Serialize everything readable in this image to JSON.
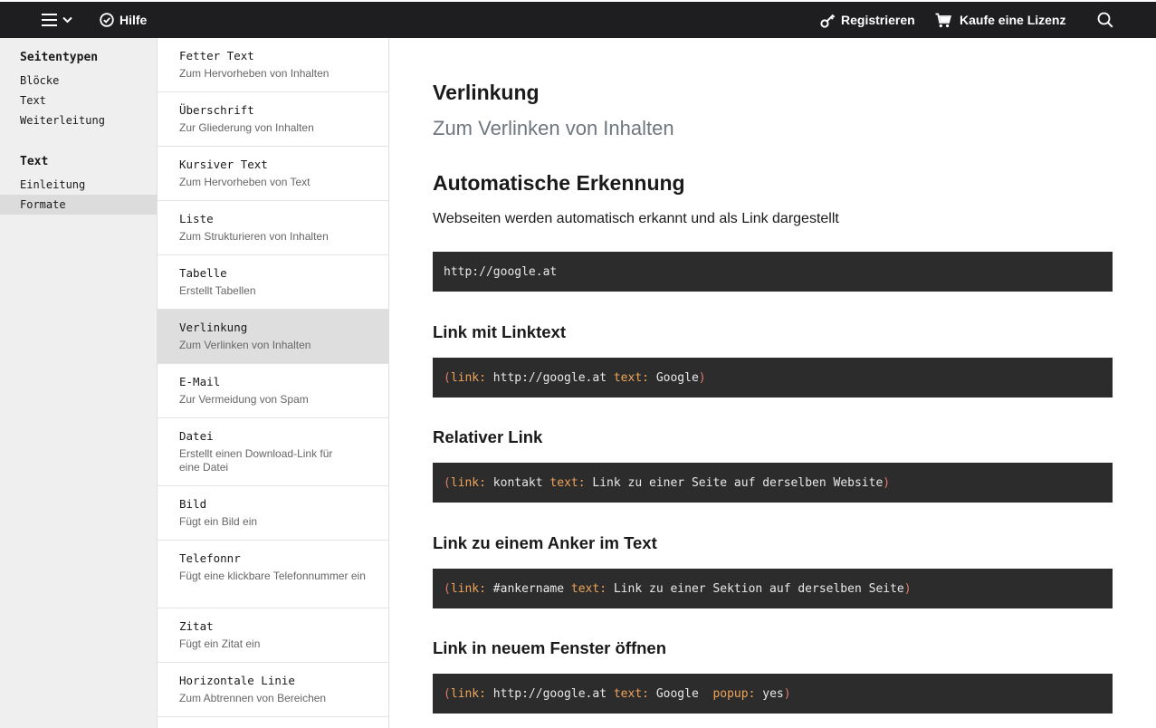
{
  "topbar": {
    "menu_icon": "hamburger-icon",
    "help_label": "Hilfe",
    "register_label": "Registrieren",
    "license_label": "Kaufe eine Lizenz"
  },
  "sidebar": {
    "groups": [
      {
        "heading": "Seitentypen",
        "items": [
          "Blöcke",
          "Text",
          "Weiterleitung"
        ]
      },
      {
        "heading": "Text",
        "items": [
          "Einleitung",
          "Formate"
        ]
      }
    ],
    "active_item": "Formate"
  },
  "subnav": {
    "items": [
      {
        "title": "Fetter Text",
        "desc": "Zum Hervorheben von Inhalten"
      },
      {
        "title": "Überschrift",
        "desc": "Zur Gliederung von Inhalten"
      },
      {
        "title": "Kursiver Text",
        "desc": "Zum Hervorheben von Text"
      },
      {
        "title": "Liste",
        "desc": "Zum Strukturieren von Inhalten"
      },
      {
        "title": "Tabelle",
        "desc": "Erstellt Tabellen"
      },
      {
        "title": "Verlinkung",
        "desc": "Zum Verlinken von Inhalten"
      },
      {
        "title": "E-Mail",
        "desc": "Zur Vermeidung von Spam"
      },
      {
        "title": "Datei",
        "desc": "Erstellt einen Download-Link für eine Datei"
      },
      {
        "title": "Bild",
        "desc": "Fügt ein Bild ein"
      },
      {
        "title": "Telefonnr",
        "desc": "Fügt eine klickbare Telefonnummer ein"
      },
      {
        "title": "Zitat",
        "desc": "Fügt ein Zitat ein"
      },
      {
        "title": "Horizontale Linie",
        "desc": "Zum Abtrennen von Bereichen"
      }
    ],
    "active_title": "Verlinkung"
  },
  "main": {
    "title": "Verlinkung",
    "subtitle": "Zum Verlinken von Inhalten",
    "section_title": "Automatische Erkennung",
    "intro": "Webseiten werden automatisch erkannt und als Link dargestellt",
    "auto_code": "http://google.at",
    "examples": [
      {
        "title": "Link mit Linktext",
        "tokens": [
          {
            "t": "paren",
            "v": "("
          },
          {
            "t": "key",
            "v": "link:"
          },
          {
            "t": "plain",
            "v": " http://google.at "
          },
          {
            "t": "key",
            "v": "text:"
          },
          {
            "t": "plain",
            "v": " Google"
          },
          {
            "t": "paren",
            "v": ")"
          }
        ]
      },
      {
        "title": "Relativer Link",
        "tokens": [
          {
            "t": "paren",
            "v": "("
          },
          {
            "t": "key",
            "v": "link:"
          },
          {
            "t": "plain",
            "v": " kontakt "
          },
          {
            "t": "key",
            "v": "text:"
          },
          {
            "t": "plain",
            "v": " Link zu einer Seite auf derselben Website"
          },
          {
            "t": "paren",
            "v": ")"
          }
        ]
      },
      {
        "title": "Link zu einem Anker im Text",
        "tokens": [
          {
            "t": "paren",
            "v": "("
          },
          {
            "t": "key",
            "v": "link:"
          },
          {
            "t": "plain",
            "v": " #ankername "
          },
          {
            "t": "key",
            "v": "text:"
          },
          {
            "t": "plain",
            "v": " Link zu einer Sektion auf derselben Seite"
          },
          {
            "t": "paren",
            "v": ")"
          }
        ]
      },
      {
        "title": "Link in neuem Fenster öffnen",
        "tokens": [
          {
            "t": "paren",
            "v": "("
          },
          {
            "t": "key",
            "v": "link:"
          },
          {
            "t": "plain",
            "v": " http://google.at "
          },
          {
            "t": "key",
            "v": "text:"
          },
          {
            "t": "plain",
            "v": " Google  "
          },
          {
            "t": "key",
            "v": "popup:"
          },
          {
            "t": "plain",
            "v": " yes"
          },
          {
            "t": "paren",
            "v": ")"
          }
        ]
      }
    ]
  },
  "colors": {
    "topbar_bg": "#1e1e20",
    "sidebar_bg": "#efefef",
    "active_bg": "#dedede",
    "code_bg": "#2c2c2c",
    "code_paren": "#e07c6a",
    "code_key": "#f0a35a",
    "subtitle": "#70767d"
  }
}
